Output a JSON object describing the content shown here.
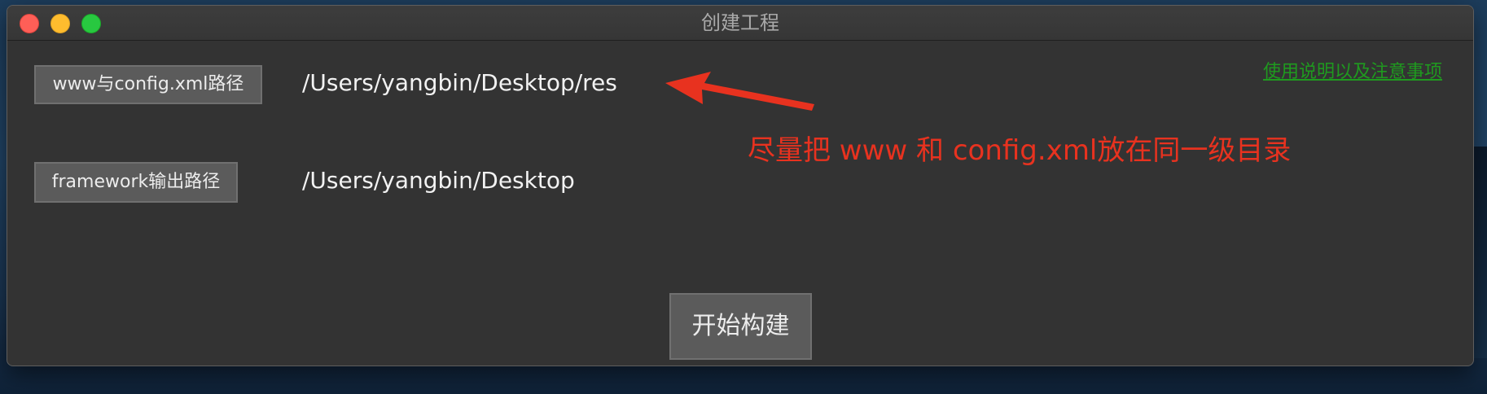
{
  "window": {
    "title": "创建工程"
  },
  "form": {
    "www_button_label": "www与config.xml路径",
    "www_path": "/Users/yangbin/Desktop/res",
    "framework_button_label": "framework输出路径",
    "framework_path": "/Users/yangbin/Desktop",
    "build_button_label": "开始构建"
  },
  "help_link": "使用说明以及注意事项",
  "annotation": {
    "text": "尽量把 www 和 config.xml放在同一级目录",
    "color": "#e8321f"
  },
  "colors": {
    "window_bg": "#333333",
    "help_link": "#1f9a1f",
    "traffic_close": "#fe5f57",
    "traffic_min": "#febc2e",
    "traffic_max": "#28c840"
  }
}
